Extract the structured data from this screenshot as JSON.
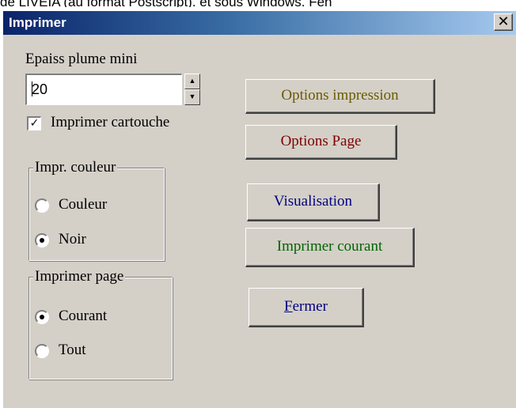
{
  "background_text": "de LIVEIA (au format Postscript). et sous Windows. Fen",
  "window": {
    "title": "Imprimer",
    "close_icon": "close-icon"
  },
  "pen": {
    "label": "Epaiss plume mini",
    "value": "20",
    "spin_up_icon": "▲",
    "spin_down_icon": "▼"
  },
  "print_cartouche": {
    "label": "Imprimer cartouche",
    "checked": true
  },
  "color_group": {
    "legend": "Impr. couleur",
    "options": [
      {
        "label": "Couleur",
        "checked": false
      },
      {
        "label": "Noir",
        "checked": true
      }
    ]
  },
  "page_group": {
    "legend": "Imprimer page",
    "options": [
      {
        "label": "Courant",
        "checked": true
      },
      {
        "label": "Tout",
        "checked": false
      }
    ]
  },
  "buttons": {
    "options_impression": {
      "label": "Options impression",
      "color": "#6b5a00"
    },
    "options_page": {
      "pre": "Options Pa",
      "accel": "g",
      "post": "e",
      "color": "#800000"
    },
    "visualisation": {
      "label": "Visualisation",
      "color": "#000080"
    },
    "imprimer_courant": {
      "label": "Imprimer courant",
      "color": "#006400"
    },
    "fermer": {
      "accel": "F",
      "post": "ermer",
      "color": "#000080"
    }
  }
}
